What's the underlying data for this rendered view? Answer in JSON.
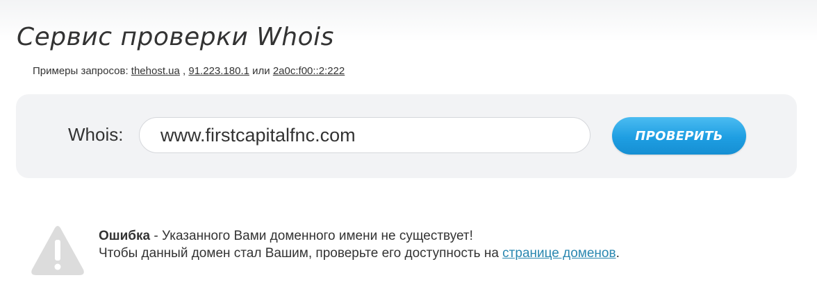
{
  "page": {
    "title": "Сервис проверки Whois"
  },
  "examples": {
    "prefix": "Примеры запросов:",
    "link1": "thehost.ua",
    "separator": ",",
    "link2": "91.223.180.1",
    "or_text": "или",
    "link3": "2a0c:f00::2:222"
  },
  "search": {
    "label": "Whois:",
    "value": "www.firstcapitalfnc.com",
    "button_label": "ПРОВЕРИТЬ"
  },
  "error": {
    "icon": "warning-triangle-icon",
    "title": "Ошибка",
    "message": " - Указанного Вами доменного имени не существует!",
    "hint": "Чтобы данный домен стал Вашим, проверьте его доступность на ",
    "link_text": "странице доменов",
    "hint_end": "."
  },
  "colors": {
    "button": "#1e9ee2",
    "link": "#2a87b0",
    "panel": "#f2f3f5",
    "icon": "#dcdcdc"
  }
}
